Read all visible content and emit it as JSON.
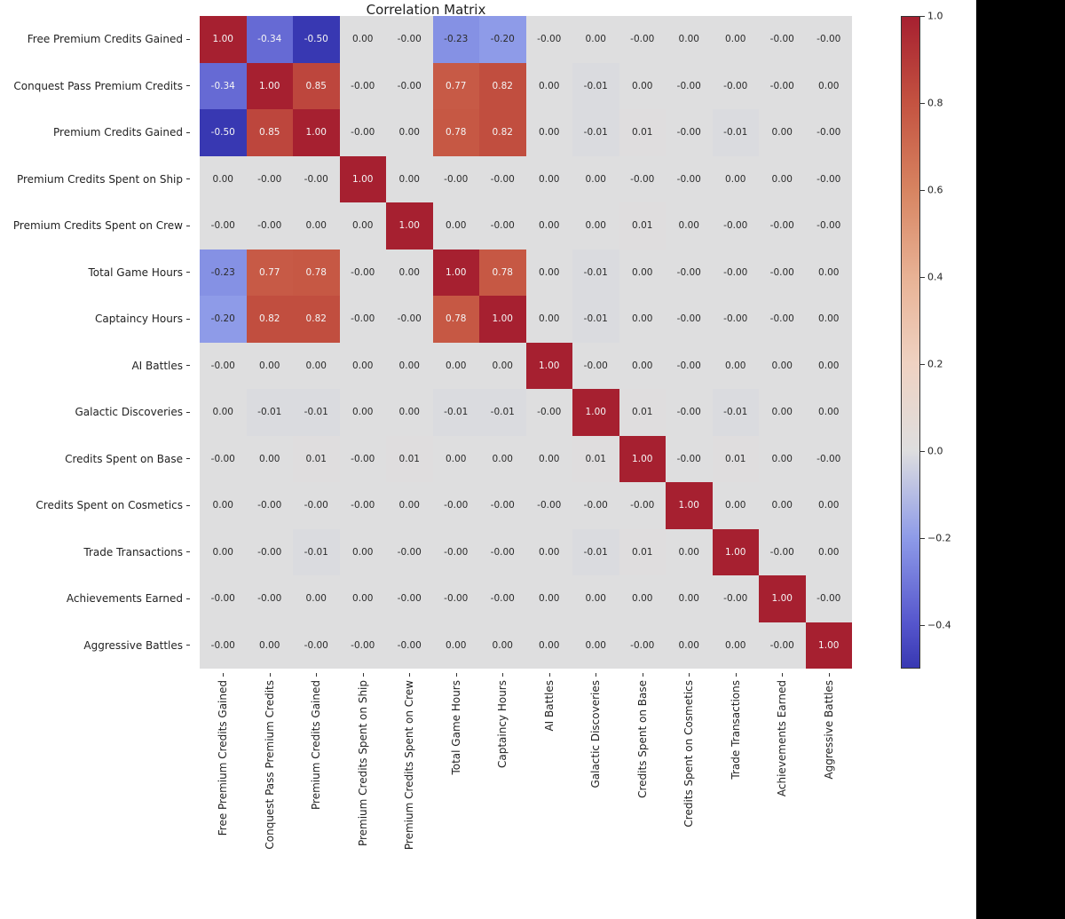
{
  "chart_data": {
    "type": "heatmap",
    "title": "Correlation Matrix",
    "labels": [
      "Free Premium Credits Gained",
      "Conquest Pass Premium Credits",
      "Premium Credits Gained",
      "Premium Credits Spent on Ship",
      "Premium Credits Spent on Crew",
      "Total Game Hours",
      "Captaincy Hours",
      "AI Battles",
      "Galactic Discoveries",
      "Credits Spent on Base",
      "Credits Spent on Cosmetics",
      "Trade Transactions",
      "Achievements Earned",
      "Aggressive Battles"
    ],
    "matrix": [
      [
        1.0,
        -0.34,
        -0.5,
        0.0,
        -0.0,
        -0.23,
        -0.2,
        -0.0,
        0.0,
        -0.0,
        0.0,
        0.0,
        -0.0,
        -0.0
      ],
      [
        -0.34,
        1.0,
        0.85,
        -0.0,
        -0.0,
        0.77,
        0.82,
        0.0,
        -0.01,
        0.0,
        -0.0,
        -0.0,
        -0.0,
        0.0
      ],
      [
        -0.5,
        0.85,
        1.0,
        -0.0,
        0.0,
        0.78,
        0.82,
        0.0,
        -0.01,
        0.01,
        -0.0,
        -0.01,
        0.0,
        -0.0
      ],
      [
        0.0,
        -0.0,
        -0.0,
        1.0,
        0.0,
        -0.0,
        -0.0,
        0.0,
        0.0,
        -0.0,
        -0.0,
        0.0,
        0.0,
        -0.0
      ],
      [
        -0.0,
        -0.0,
        0.0,
        0.0,
        1.0,
        0.0,
        -0.0,
        0.0,
        0.0,
        0.01,
        0.0,
        -0.0,
        -0.0,
        -0.0
      ],
      [
        -0.23,
        0.77,
        0.78,
        -0.0,
        0.0,
        1.0,
        0.78,
        0.0,
        -0.01,
        0.0,
        -0.0,
        -0.0,
        -0.0,
        0.0
      ],
      [
        -0.2,
        0.82,
        0.82,
        -0.0,
        -0.0,
        0.78,
        1.0,
        0.0,
        -0.01,
        0.0,
        -0.0,
        -0.0,
        -0.0,
        0.0
      ],
      [
        -0.0,
        0.0,
        0.0,
        0.0,
        0.0,
        0.0,
        0.0,
        1.0,
        -0.0,
        0.0,
        -0.0,
        0.0,
        0.0,
        0.0
      ],
      [
        0.0,
        -0.01,
        -0.01,
        0.0,
        0.0,
        -0.01,
        -0.01,
        -0.0,
        1.0,
        0.01,
        -0.0,
        -0.01,
        0.0,
        0.0
      ],
      [
        -0.0,
        0.0,
        0.01,
        -0.0,
        0.01,
        0.0,
        0.0,
        0.0,
        0.01,
        1.0,
        -0.0,
        0.01,
        0.0,
        -0.0
      ],
      [
        0.0,
        -0.0,
        -0.0,
        -0.0,
        0.0,
        -0.0,
        -0.0,
        -0.0,
        -0.0,
        -0.0,
        1.0,
        0.0,
        0.0,
        0.0
      ],
      [
        0.0,
        -0.0,
        -0.01,
        0.0,
        -0.0,
        -0.0,
        -0.0,
        0.0,
        -0.01,
        0.01,
        0.0,
        1.0,
        -0.0,
        0.0
      ],
      [
        -0.0,
        -0.0,
        0.0,
        0.0,
        -0.0,
        -0.0,
        -0.0,
        0.0,
        0.0,
        0.0,
        0.0,
        -0.0,
        1.0,
        -0.0
      ],
      [
        -0.0,
        0.0,
        -0.0,
        -0.0,
        -0.0,
        0.0,
        0.0,
        0.0,
        0.0,
        -0.0,
        0.0,
        0.0,
        -0.0,
        1.0
      ]
    ],
    "colorbar": {
      "domain": [
        -0.5,
        1.0
      ],
      "ticks": [
        -0.4,
        -0.2,
        0.0,
        0.2,
        0.4,
        0.6,
        0.8,
        1.0
      ],
      "tick_labels": [
        "−0.4",
        "−0.2",
        "0.0",
        "0.2",
        "0.4",
        "0.6",
        "0.8",
        "1.0"
      ]
    }
  }
}
